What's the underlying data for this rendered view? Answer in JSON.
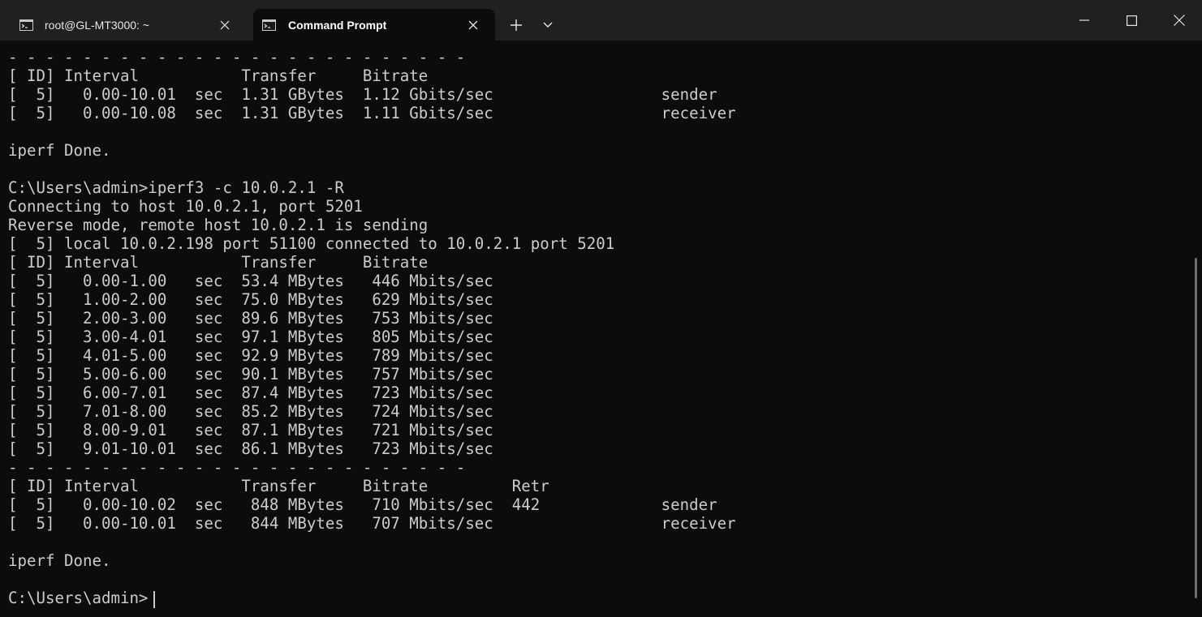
{
  "window": {
    "tabs": [
      {
        "label": "root@GL-MT3000: ~",
        "active": false,
        "icon": "terminal-icon"
      },
      {
        "label": "Command Prompt",
        "active": true,
        "icon": "terminal-icon"
      }
    ],
    "controls": [
      "new-tab",
      "tab-dropdown",
      "minimize",
      "maximize",
      "close"
    ]
  },
  "terminal": {
    "lines": [
      "- - - - - - - - - - - - - - - - - - - - - - - - -",
      "[ ID] Interval           Transfer     Bitrate",
      "[  5]   0.00-10.01  sec  1.31 GBytes  1.12 Gbits/sec                  sender",
      "[  5]   0.00-10.08  sec  1.31 GBytes  1.11 Gbits/sec                  receiver",
      "",
      "iperf Done.",
      "",
      "C:\\Users\\admin>iperf3 -c 10.0.2.1 -R",
      "Connecting to host 10.0.2.1, port 5201",
      "Reverse mode, remote host 10.0.2.1 is sending",
      "[  5] local 10.0.2.198 port 51100 connected to 10.0.2.1 port 5201",
      "[ ID] Interval           Transfer     Bitrate",
      "[  5]   0.00-1.00   sec  53.4 MBytes   446 Mbits/sec",
      "[  5]   1.00-2.00   sec  75.0 MBytes   629 Mbits/sec",
      "[  5]   2.00-3.00   sec  89.6 MBytes   753 Mbits/sec",
      "[  5]   3.00-4.01   sec  97.1 MBytes   805 Mbits/sec",
      "[  5]   4.01-5.00   sec  92.9 MBytes   789 Mbits/sec",
      "[  5]   5.00-6.00   sec  90.1 MBytes   757 Mbits/sec",
      "[  5]   6.00-7.01   sec  87.4 MBytes   723 Mbits/sec",
      "[  5]   7.01-8.00   sec  85.2 MBytes   724 Mbits/sec",
      "[  5]   8.00-9.01   sec  87.1 MBytes   721 Mbits/sec",
      "[  5]   9.01-10.01  sec  86.1 MBytes   723 Mbits/sec",
      "- - - - - - - - - - - - - - - - - - - - - - - - -",
      "[ ID] Interval           Transfer     Bitrate         Retr",
      "[  5]   0.00-10.02  sec   848 MBytes   710 Mbits/sec  442             sender",
      "[  5]   0.00-10.01  sec   844 MBytes   707 Mbits/sec                  receiver",
      "",
      "iperf Done.",
      "",
      "C:\\Users\\admin>"
    ]
  },
  "colors": {
    "titlebar": "#202020",
    "terminal_bg": "#0c0c0c",
    "terminal_fg": "#cccccc"
  }
}
